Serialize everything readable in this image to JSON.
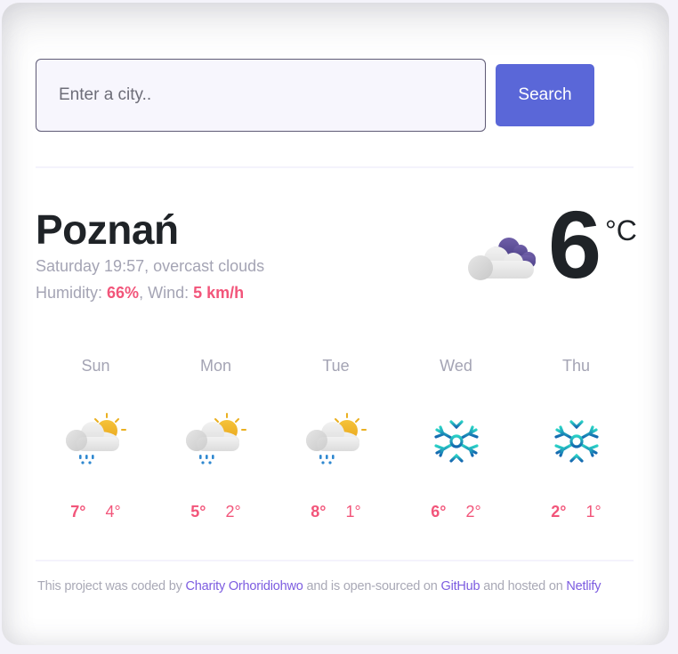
{
  "search": {
    "placeholder": "Enter a city..",
    "value": "",
    "button_label": "Search"
  },
  "current": {
    "city": "Poznań",
    "day_time": "Saturday 19:57",
    "description": "overcast clouds",
    "humidity_label": "Humidity:",
    "humidity": "66%",
    "wind_label": "Wind:",
    "wind": "5 km/h",
    "temperature": "6",
    "unit": "°C",
    "icon": "overcast-clouds-icon"
  },
  "forecast": [
    {
      "day": "Sun",
      "icon": "rain-sun-cloud-icon",
      "max": "7°",
      "min": "4°"
    },
    {
      "day": "Mon",
      "icon": "rain-sun-cloud-icon",
      "max": "5°",
      "min": "2°"
    },
    {
      "day": "Tue",
      "icon": "rain-sun-cloud-icon",
      "max": "8°",
      "min": "1°"
    },
    {
      "day": "Wed",
      "icon": "snowflake-icon",
      "max": "6°",
      "min": "2°"
    },
    {
      "day": "Thu",
      "icon": "snowflake-icon",
      "max": "2°",
      "min": "1°"
    }
  ],
  "footer": {
    "text1": "This project was coded by ",
    "author": "Charity Orhoridiohwo",
    "text2": " and is open-sourced on ",
    "github": "GitHub",
    "text3": " and hosted on ",
    "netlify": "Netlify"
  },
  "colors": {
    "accent": "#f2557a",
    "button": "#5a67d8",
    "link": "#7c5ce0",
    "muted": "#a4a4b4",
    "text": "#1f2327"
  }
}
